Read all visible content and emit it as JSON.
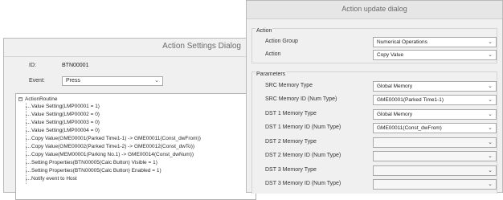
{
  "settings_window": {
    "title": "Action Settings Dialog",
    "id_label": "ID:",
    "id_value": "BTN00001",
    "event_label": "Event:",
    "event_value": "Press",
    "tree": {
      "root": "ActionRoutine",
      "items": [
        "Value Setting(LMP00001 = 1)",
        "Value Setting(LMP00002 = 0)",
        "Value Setting(LMP00003 = 0)",
        "Value Setting(LMP00004 = 0)",
        "Copy Value(GME00001(Parked Time1-1) -> GME00011(Const_dwFrom))",
        "Copy Value(GME00002(Parked Time1-2) -> GME00012(Const_dwTo))",
        "Copy Value(MEM00001(Parking No.1) -> GME00014(Const_dwNum))",
        "Setting Properties(BTN00005(Calc Button) Visible = 1)",
        "Setting Properties(BTN00005(Calc Button) Enabled = 1)",
        "Notify event to Host"
      ]
    }
  },
  "update_dialog": {
    "title": "Action update dialog",
    "action_group": {
      "title": "Action",
      "rows": [
        {
          "label": "Action Group",
          "value": "Numerical Operations"
        },
        {
          "label": "Action",
          "value": "Copy Value"
        }
      ]
    },
    "parameters_group": {
      "title": "Parameters",
      "rows": [
        {
          "label": "SRC Memory Type",
          "value": "Global Memory"
        },
        {
          "label": "SRC Memory ID (Num Type)",
          "value": "GME00001(Parked Time1-1)"
        },
        {
          "label": "DST 1 Memory Type",
          "value": "Global Memory"
        },
        {
          "label": "DST 1 Memory ID (Num Type)",
          "value": "GME00011(Const_dwFrom)"
        },
        {
          "label": "DST 2 Memory Type",
          "value": ""
        },
        {
          "label": "DST 2 Memory ID (Num Type)",
          "value": ""
        },
        {
          "label": "DST 3 Memory Type",
          "value": ""
        },
        {
          "label": "DST 3 Memory ID (Num Type)",
          "value": ""
        }
      ]
    }
  },
  "icons": {
    "dropdown": "chevron-down-icon",
    "tree_toggle": "tree-collapse-icon"
  },
  "chevron_glyph": "⌄",
  "collapse_glyph": "−"
}
